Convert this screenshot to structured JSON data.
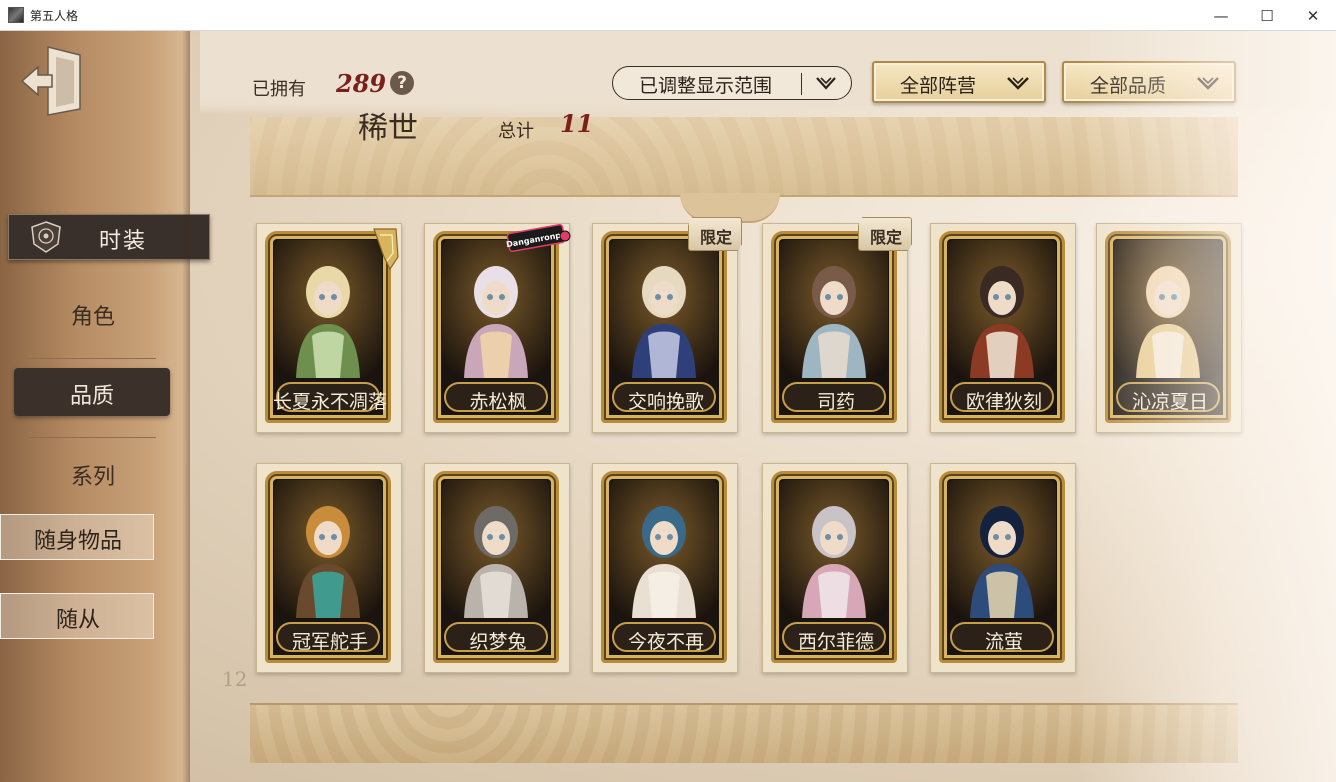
{
  "window": {
    "title": "第五人格",
    "minimize": "—",
    "maximize": "☐",
    "close": "✕"
  },
  "sidebar": {
    "back_icon": "exit-door-icon",
    "skin_tab": "时装",
    "items": {
      "role": "角色",
      "quality": "品质",
      "series": "系列",
      "accessory": "随身物品",
      "pet": "随从"
    }
  },
  "header": {
    "owned_label": "已拥有",
    "owned_count": "289",
    "help": "?",
    "range_dropdown": "已调整显示范围",
    "faction_dropdown": "全部阵营",
    "quality_dropdown": "全部品质"
  },
  "category": {
    "title": "稀世",
    "total_label": "总计",
    "total_count": "11"
  },
  "cards": [
    {
      "name": "长夏永不凋落",
      "tag": ""
    },
    {
      "name": "赤松枫",
      "tag": "Danganronpa"
    },
    {
      "name": "交响挽歌",
      "tag": "限定"
    },
    {
      "name": "司药",
      "tag": "限定"
    },
    {
      "name": "欧律狄刻",
      "tag": ""
    },
    {
      "name": "沁凉夏日",
      "tag": ""
    },
    {
      "name": "冠军舵手",
      "tag": ""
    },
    {
      "name": "织梦兔",
      "tag": ""
    },
    {
      "name": "今夜不再",
      "tag": ""
    },
    {
      "name": "西尔菲德",
      "tag": ""
    },
    {
      "name": "流萤",
      "tag": ""
    }
  ],
  "background_number": "12",
  "colors": {
    "accent_red": "#7a1f1a",
    "gold_frame": "#b88d3a",
    "dark_panel": "#3b312a"
  }
}
